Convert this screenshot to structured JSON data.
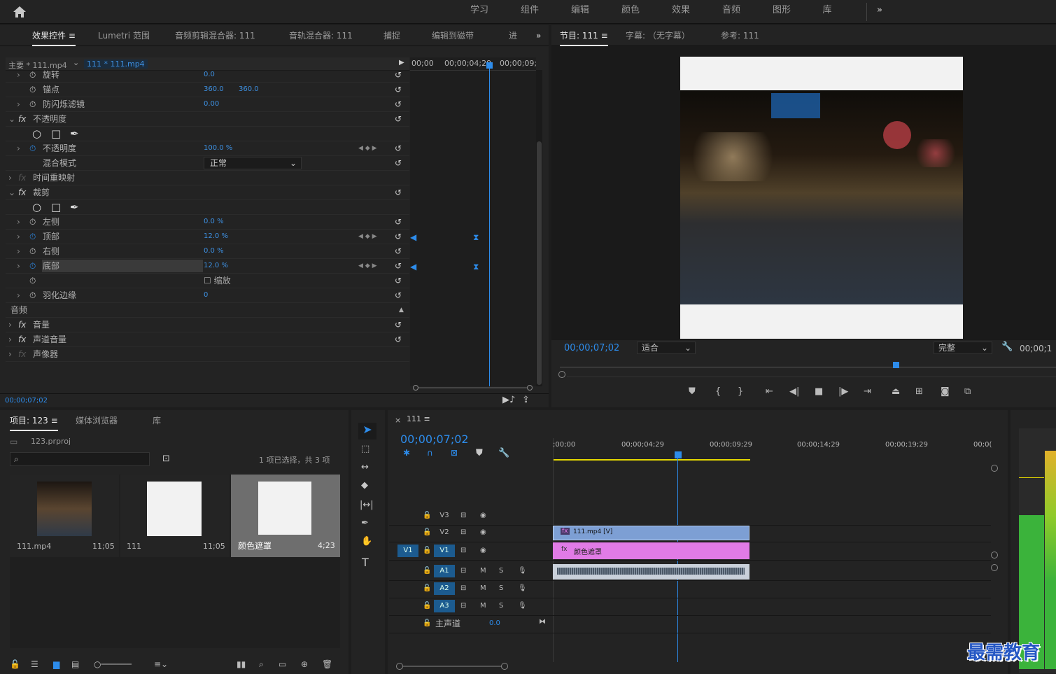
{
  "topbar": {
    "workspaces": [
      "学习",
      "组件",
      "编辑",
      "颜色",
      "效果",
      "音频",
      "图形",
      "库"
    ],
    "more": "»"
  },
  "effect_panel": {
    "tabs": [
      "效果控件",
      "Lumetri 范围",
      "音频剪辑混合器: 111",
      "音轨混合器: 111",
      "捕捉",
      "编辑到磁带",
      "进"
    ],
    "active_tab": "效果控件",
    "clip_master": "主要 * 111.mp4",
    "clip_seq": "111 * 111.mp4",
    "ruler": [
      "00;00",
      "00;00;04;29",
      "00;00;09;"
    ],
    "current_time": "00;00;07;02",
    "rows": [
      {
        "name": "旋转",
        "v1": "0.0",
        "v2": ""
      },
      {
        "name": "锚点",
        "v1": "360.0",
        "v2": "360.0"
      },
      {
        "name": "防闪烁滤镜",
        "v1": "0.00",
        "v2": ""
      },
      {
        "name": "不透明度",
        "v1": "",
        "v2": ""
      },
      {
        "name": "",
        "v1": "",
        "v2": ""
      },
      {
        "name": "不透明度",
        "v1": "100.0 %",
        "v2": ""
      },
      {
        "name": "混合模式",
        "v1": "正常",
        "v2": ""
      },
      {
        "name": "时间重映射",
        "v1": "",
        "v2": ""
      },
      {
        "name": "裁剪",
        "v1": "",
        "v2": ""
      },
      {
        "name": "",
        "v1": "",
        "v2": ""
      },
      {
        "name": "左侧",
        "v1": "0.0 %",
        "v2": ""
      },
      {
        "name": "顶部",
        "v1": "12.0 %",
        "v2": ""
      },
      {
        "name": "右侧",
        "v1": "0.0 %",
        "v2": ""
      },
      {
        "name": "底部",
        "v1": "12.0 %",
        "v2": ""
      },
      {
        "name": "",
        "v1": "缩放",
        "v2": ""
      },
      {
        "name": "羽化边缘",
        "v1": "0",
        "v2": ""
      },
      {
        "name": "音频",
        "v1": "",
        "v2": ""
      },
      {
        "name": "音量",
        "v1": "",
        "v2": ""
      },
      {
        "name": "声道音量",
        "v1": "",
        "v2": ""
      },
      {
        "name": "声像器",
        "v1": "",
        "v2": ""
      }
    ]
  },
  "program": {
    "tabs": [
      "节目: 111",
      "字幕: （无字幕）",
      "参考: 111"
    ],
    "timecode": "00;00;07;02",
    "fit": "适合",
    "quality": "完整",
    "duration": "00;00;1"
  },
  "project": {
    "tabs": [
      "项目: 123",
      "媒体浏览器",
      "库"
    ],
    "file": "123.prproj",
    "selection": "1 项已选择，共 3 项",
    "search_placeholder": "",
    "items": [
      {
        "name": "111.mp4",
        "duration": "11;05"
      },
      {
        "name": "111",
        "duration": "11;05"
      },
      {
        "name": "颜色遮罩",
        "duration": "4;23"
      }
    ]
  },
  "timeline": {
    "title": "111",
    "timecode": "00;00;07;02",
    "ruler": [
      ";00;00",
      "00;00;04;29",
      "00;00;09;29",
      "00;00;14;29",
      "00;00;19;29",
      "00;0("
    ],
    "tracks": [
      "V3",
      "V2",
      "V1",
      "A1",
      "A2",
      "A3"
    ],
    "master": "主声道",
    "master_val": "0.0",
    "clip_v2": "111.mp4 [V]",
    "clip_v1": "颜色遮罩"
  },
  "watermark": "最需教育",
  "colors": {
    "accent": "#2d8ceb",
    "clip_blue": "#7d9fd4",
    "clip_pink": "#e17be6",
    "yellow": "#e5d800"
  }
}
